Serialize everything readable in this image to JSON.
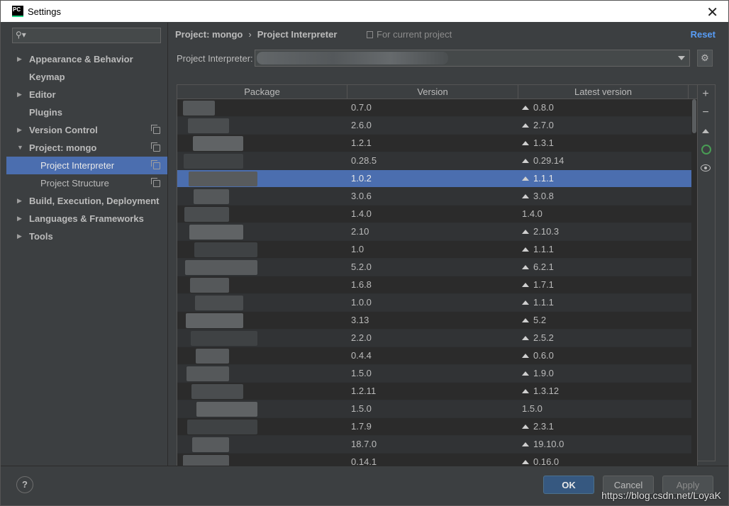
{
  "window": {
    "title": "Settings",
    "app_icon_text": "PC"
  },
  "sidebar": {
    "search_placeholder": "",
    "items": [
      {
        "label": "Appearance & Behavior",
        "arrow": "▶",
        "copy": false
      },
      {
        "label": "Keymap",
        "arrow": "",
        "copy": false
      },
      {
        "label": "Editor",
        "arrow": "▶",
        "copy": false
      },
      {
        "label": "Plugins",
        "arrow": "",
        "copy": false
      },
      {
        "label": "Version Control",
        "arrow": "▶",
        "copy": true
      },
      {
        "label": "Project: mongo",
        "arrow": "▼",
        "copy": true
      },
      {
        "label": "Project Interpreter",
        "arrow": "",
        "copy": true
      },
      {
        "label": "Project Structure",
        "arrow": "",
        "copy": true
      },
      {
        "label": "Build, Execution, Deployment",
        "arrow": "▶",
        "copy": false
      },
      {
        "label": "Languages & Frameworks",
        "arrow": "▶",
        "copy": false
      },
      {
        "label": "Tools",
        "arrow": "▶",
        "copy": false
      }
    ]
  },
  "header": {
    "breadcrumb_project": "Project: mongo",
    "breadcrumb_sep": "›",
    "breadcrumb_page": "Project Interpreter",
    "scope": "For current project",
    "reset": "Reset"
  },
  "interpreter": {
    "label": "Project Interpreter:",
    "value": ""
  },
  "table": {
    "columns": [
      "Package",
      "Version",
      "Latest version"
    ],
    "selected_row": 4,
    "rows": [
      {
        "package": "",
        "version": "0.7.0",
        "latest": "0.8.0",
        "upgrade": true
      },
      {
        "package": "",
        "version": "2.6.0",
        "latest": "2.7.0",
        "upgrade": true
      },
      {
        "package": "",
        "version": "1.2.1",
        "latest": "1.3.1",
        "upgrade": true
      },
      {
        "package": "",
        "version": "0.28.5",
        "latest": "0.29.14",
        "upgrade": true
      },
      {
        "package": "",
        "version": "1.0.2",
        "latest": "1.1.1",
        "upgrade": true
      },
      {
        "package": "",
        "version": "3.0.6",
        "latest": "3.0.8",
        "upgrade": true
      },
      {
        "package": "",
        "version": "1.4.0",
        "latest": "1.4.0",
        "upgrade": false
      },
      {
        "package": "",
        "version": "2.10",
        "latest": "2.10.3",
        "upgrade": true
      },
      {
        "package": "",
        "version": "1.0",
        "latest": "1.1.1",
        "upgrade": true
      },
      {
        "package": "",
        "version": "5.2.0",
        "latest": "6.2.1",
        "upgrade": true
      },
      {
        "package": "",
        "version": "1.6.8",
        "latest": "1.7.1",
        "upgrade": true
      },
      {
        "package": "",
        "version": "1.0.0",
        "latest": "1.1.1",
        "upgrade": true
      },
      {
        "package": "",
        "version": "3.13",
        "latest": "5.2",
        "upgrade": true
      },
      {
        "package": "",
        "version": "2.2.0",
        "latest": "2.5.2",
        "upgrade": true
      },
      {
        "package": "",
        "version": "0.4.4",
        "latest": "0.6.0",
        "upgrade": true
      },
      {
        "package": "",
        "version": "1.5.0",
        "latest": "1.9.0",
        "upgrade": true
      },
      {
        "package": "",
        "version": "1.2.11",
        "latest": "1.3.12",
        "upgrade": true
      },
      {
        "package": "",
        "version": "1.5.0",
        "latest": "1.5.0",
        "upgrade": false
      },
      {
        "package": "",
        "version": "1.7.9",
        "latest": "2.3.1",
        "upgrade": true
      },
      {
        "package": "",
        "version": "18.7.0",
        "latest": "19.10.0",
        "upgrade": true
      },
      {
        "package": "",
        "version": "0.14.1",
        "latest": "0.16.0",
        "upgrade": true
      }
    ]
  },
  "tools": [
    "add-icon",
    "remove-icon",
    "upgrade-icon",
    "busy-ring-icon",
    "eye-icon"
  ],
  "footer": {
    "help": "?",
    "ok": "OK",
    "cancel": "Cancel",
    "apply": "Apply"
  },
  "watermark": "https://blog.csdn.net/LoyaK",
  "colors": {
    "selection": "#4b6eaf",
    "link": "#589df6",
    "ok_button": "#365880",
    "busy_ring": "#499c54"
  }
}
